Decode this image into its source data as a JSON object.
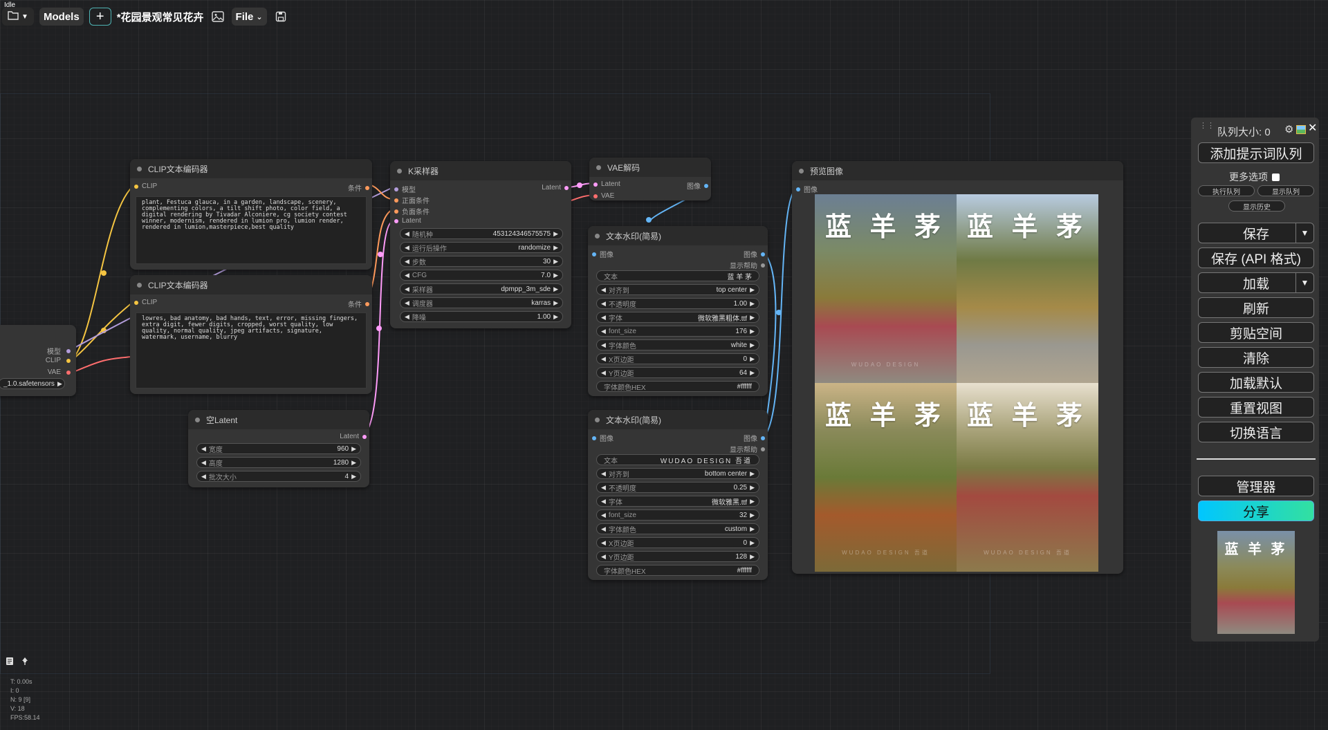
{
  "status": "Idle",
  "topbar": {
    "models_label": "Models",
    "add_label": "+",
    "workflow_title": "*花园景观常见花卉",
    "file_label": "File"
  },
  "nodes": {
    "clip_pos": {
      "title": "CLIP文本编码器",
      "in_clip": "CLIP",
      "out_cond": "条件",
      "text": "plant, Festuca glauca, in a garden, landscape, scenery, complementing colors, a tilt shift photo, color field, a digital rendering by Tivadar Alconiere, cg society contest winner, modernism, rendered in lumion pro, lumion render, rendered in lumion,masterpiece,best quality"
    },
    "clip_neg": {
      "title": "CLIP文本编码器",
      "in_clip": "CLIP",
      "out_cond": "条件",
      "text": "lowres, bad anatomy, bad hands, text, error, missing fingers, extra digit, fewer digits, cropped, worst quality, low quality, normal quality, jpeg artifacts, signature, watermark, username, blurry"
    },
    "ckpt": {
      "out_model": "模型",
      "out_clip": "CLIP",
      "out_vae": "VAE",
      "ckpt_name": "_1.0.safetensors"
    },
    "latent": {
      "title": "空Latent",
      "out_latent": "Latent",
      "widgets": [
        {
          "label": "宽度",
          "value": "960"
        },
        {
          "label": "高度",
          "value": "1280"
        },
        {
          "label": "批次大小",
          "value": "4"
        }
      ]
    },
    "ksampler": {
      "title": "K采样器",
      "inputs": [
        "模型",
        "正面条件",
        "负面条件",
        "Latent"
      ],
      "out_latent": "Latent",
      "widgets": [
        {
          "label": "随机种",
          "value": "453124346575575"
        },
        {
          "label": "运行后操作",
          "value": "randomize"
        },
        {
          "label": "步数",
          "value": "30"
        },
        {
          "label": "CFG",
          "value": "7.0"
        },
        {
          "label": "采样器",
          "value": "dpmpp_3m_sde"
        },
        {
          "label": "调度器",
          "value": "karras"
        },
        {
          "label": "降噪",
          "value": "1.00"
        }
      ]
    },
    "vae_decode": {
      "title": "VAE解码",
      "in_latent": "Latent",
      "in_vae": "VAE",
      "out_image": "图像"
    },
    "wm1": {
      "title": "文本水印(简易)",
      "in_image": "图像",
      "out_image": "图像",
      "out_help": "显示帮助",
      "text_label": "文本",
      "text_value": "蓝 羊 茅",
      "widgets": [
        {
          "label": "对齐到",
          "value": "top center"
        },
        {
          "label": "不透明度",
          "value": "1.00"
        },
        {
          "label": "字体",
          "value": "微软雅黑粗体.ttf"
        },
        {
          "label": "font_size",
          "value": "176"
        },
        {
          "label": "字体颜色",
          "value": "white"
        },
        {
          "label": "X页边距",
          "value": "0"
        },
        {
          "label": "Y页边距",
          "value": "64"
        }
      ],
      "hex_label": "字体颜色HEX",
      "hex_value": "#ffffff"
    },
    "wm2": {
      "title": "文本水印(简易)",
      "in_image": "图像",
      "out_image": "图像",
      "out_help": "显示帮助",
      "text_label": "文本",
      "text_value": "WUDAO DESIGN 吾道",
      "widgets": [
        {
          "label": "对齐到",
          "value": "bottom center"
        },
        {
          "label": "不透明度",
          "value": "0.25"
        },
        {
          "label": "字体",
          "value": "微软雅黑.ttf"
        },
        {
          "label": "font_size",
          "value": "32"
        },
        {
          "label": "字体颜色",
          "value": "custom"
        },
        {
          "label": "X页边距",
          "value": "0"
        },
        {
          "label": "Y页边距",
          "value": "128"
        }
      ],
      "hex_label": "字体颜色HEX",
      "hex_value": "#ffffff"
    },
    "preview": {
      "title": "预览图像",
      "in_image": "图像",
      "images": [
        {
          "title": "蓝 羊 茅",
          "sub": "WUDAO DESIGN",
          "colors": [
            "#6c7f93",
            "#8a7a3a",
            "#a84a52",
            "#8f8a80"
          ]
        },
        {
          "title": "蓝 羊 茅",
          "sub": "",
          "colors": [
            "#b8cbe0",
            "#6f7a45",
            "#a58a48",
            "#9a9890"
          ]
        },
        {
          "title": "蓝 羊 茅",
          "sub": "WUDAO DESIGN 吾道",
          "colors": [
            "#cbb487",
            "#6a7a38",
            "#a45a2c",
            "#7c6a38"
          ]
        },
        {
          "title": "蓝 羊 茅",
          "sub": "WUDAO DESIGN 吾道",
          "colors": [
            "#e8e0cf",
            "#7a7a44",
            "#a34a40",
            "#8c7a4c"
          ]
        }
      ]
    }
  },
  "panel": {
    "queue_size": "队列大小: 0",
    "add_prompt": "添加提示词队列",
    "more_options": "更多选项",
    "execute_queue": "执行队列",
    "show_queue": "显示队列",
    "show_history": "显示历史",
    "save": "保存",
    "save_api": "保存 (API 格式)",
    "load": "加载",
    "refresh": "刷新",
    "clipspace": "剪贴空间",
    "clear": "清除",
    "load_default": "加载默认",
    "reset_view": "重置视图",
    "switch_lang": "切换语言",
    "manager": "管理器",
    "share": "分享",
    "thumb_title": "蓝 羊 茅"
  },
  "stats": {
    "t": "T: 0.00s",
    "i": "I: 0",
    "n": "N: 9 [9]",
    "v": "V: 18",
    "fps": "FPS:58.14"
  },
  "colors": {
    "clip_yellow": "#f5c542",
    "cond_orange": "#ff9a5c",
    "model_purple": "#b39ddb",
    "vae_red": "#ff6e6e",
    "latent_pink": "#ff9cf9",
    "image_blue": "#64b5f6",
    "share_gradient": [
      "#00c6ff",
      "#33e0a0"
    ]
  }
}
